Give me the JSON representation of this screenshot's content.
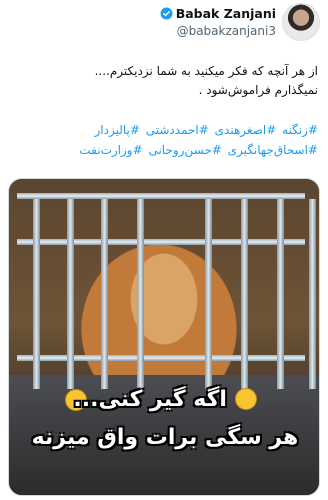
{
  "author": {
    "display_name": "Babak Zanjani",
    "handle": "@babakzanjani3",
    "verified": true
  },
  "tweet": {
    "line1": "از هر آنچه که فکر میکنید به شما نزدیکترم....",
    "line2": "نمیگذارم فراموش‌شود ."
  },
  "hashtags": {
    "row1": [
      "#زنگنه",
      "#اصغرهندی",
      "#احمددشتی",
      "#پالیزدار"
    ],
    "row2": [
      "#اسحاق‌جهانگیری",
      "#حسن‌روحانی",
      "#وزارت‌نفت"
    ]
  },
  "media": {
    "caption_top": "اگه گیر کنی...",
    "caption_bottom": "هر سگی برات واق میزنه"
  },
  "colors": {
    "link": "#1d9bf0",
    "verified": "#1d9bf0"
  }
}
